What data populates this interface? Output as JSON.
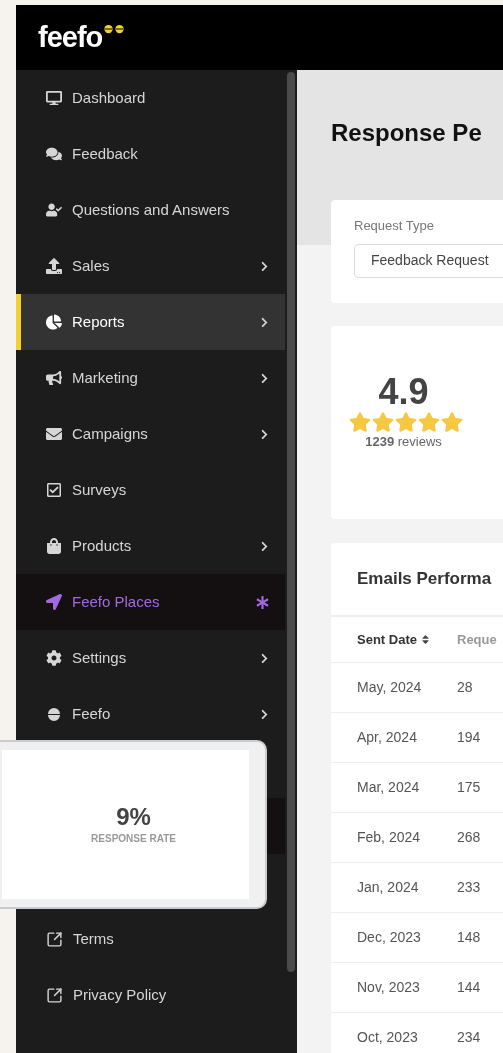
{
  "logo": {
    "text": "feefo"
  },
  "sidebar": {
    "items": [
      {
        "label": "Dashboard",
        "chevron": false,
        "selected": false,
        "kind": "normal"
      },
      {
        "label": "Feedback",
        "chevron": false,
        "selected": false,
        "kind": "normal"
      },
      {
        "label": "Questions and Answers",
        "chevron": false,
        "selected": false,
        "kind": "normal"
      },
      {
        "label": "Sales",
        "chevron": true,
        "selected": false,
        "kind": "normal"
      },
      {
        "label": "Reports",
        "chevron": true,
        "selected": true,
        "kind": "normal"
      },
      {
        "label": "Marketing",
        "chevron": true,
        "selected": false,
        "kind": "normal"
      },
      {
        "label": "Campaigns",
        "chevron": true,
        "selected": false,
        "kind": "normal"
      },
      {
        "label": "Surveys",
        "chevron": false,
        "selected": false,
        "kind": "normal"
      },
      {
        "label": "Products",
        "chevron": true,
        "selected": false,
        "kind": "normal"
      },
      {
        "label": "Feefo Places",
        "chevron": false,
        "selected": false,
        "kind": "new"
      },
      {
        "label": "Settings",
        "chevron": true,
        "selected": false,
        "kind": "normal"
      },
      {
        "label": "Feefo",
        "chevron": true,
        "selected": false,
        "kind": "normal"
      }
    ],
    "footer_links": [
      {
        "label": "Terms"
      },
      {
        "label": "Privacy Policy"
      }
    ]
  },
  "page": {
    "title": "Response Pe"
  },
  "filter": {
    "label": "Request Type",
    "value": "Feedback Request"
  },
  "rating": {
    "score": "4.9",
    "stars": 5,
    "count": "**1239** reviews"
  },
  "table": {
    "title": "Emails Performa",
    "columns": [
      "Sent Date",
      "Reque"
    ],
    "rows": [
      [
        "May, 2024",
        "28"
      ],
      [
        "Apr, 2024",
        "194"
      ],
      [
        "Mar, 2024",
        "175"
      ],
      [
        "Feb, 2024",
        "268"
      ],
      [
        "Jan, 2024",
        "233"
      ],
      [
        "Dec, 2023",
        "148"
      ],
      [
        "Nov, 2023",
        "144"
      ],
      [
        "Oct, 2023",
        "234"
      ]
    ]
  },
  "overlay_card": {
    "value": "9%",
    "label": "RESPONSE RATE"
  }
}
